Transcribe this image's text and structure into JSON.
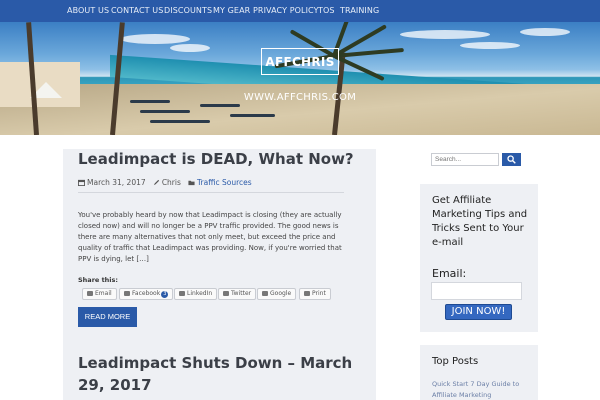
{
  "nav": {
    "items": [
      "ABOUT US",
      "CONTACT US",
      "DISCOUNTS",
      "MY GEAR",
      "PRIVACY POLICY",
      "TOS",
      "TRAINING"
    ]
  },
  "brand": {
    "title": "AFFCHRIS",
    "url": "WWW.AFFCHRIS.COM"
  },
  "post1": {
    "title": "Leadimpact is DEAD, What Now?",
    "date": "March 31, 2017",
    "author": "Chris",
    "category": "Traffic Sources",
    "excerpt": "You've probably heard by now that Leadimpact is closing (they are actually closed now) and will no longer be a PPV traffic provided. The good news is there are many alternatives that not only meet, but exceed the price and quality of traffic that Leadimpact was providing. Now, if you're worried that PPV is dying, let […]",
    "share_label": "Share this:",
    "share": {
      "email": "Email",
      "facebook": "Facebook",
      "facebook_count": "3",
      "linkedin": "LinkedIn",
      "twitter": "Twitter",
      "google": "Google",
      "print": "Print"
    },
    "read_more": "READ MORE"
  },
  "post2": {
    "title": "Leadimpact Shuts Down – March 29, 2017"
  },
  "sidebar": {
    "search_placeholder": "Search...",
    "optin_title": "Get Affiliate Marketing Tips and Tricks Sent to Your e-mail",
    "email_label": "Email:",
    "join_label": "JOIN NOW!",
    "top_posts_title": "Top Posts",
    "top_post_1": "Quick Start 7 Day Guide to Affiliate Marketing"
  },
  "colors": {
    "brand_blue": "#2a5aa8",
    "panel_gray": "#eef0f4"
  },
  "icons": [
    "calendar-icon",
    "pencil-icon",
    "folder-icon",
    "search-icon",
    "email-icon",
    "facebook-icon",
    "linkedin-icon",
    "twitter-icon",
    "google-icon",
    "print-icon"
  ]
}
